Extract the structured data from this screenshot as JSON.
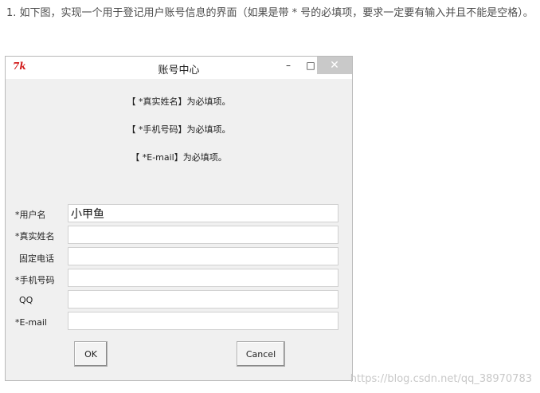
{
  "question": "1. 如下图，实现一个用于登记用户账号信息的界面（如果是带 * 号的必填项，要求一定要有输入并且不能是空格）。",
  "window": {
    "icon": "tk-feather-icon",
    "icon_text": "7k",
    "title": "账号中心",
    "minimize_glyph": "–",
    "maximize_glyph": "□",
    "close_glyph": "✕"
  },
  "notices": [
    "【 *真实姓名】为必填项。",
    "【 *手机号码】为必填项。",
    "【 *E-mail】为必填项。"
  ],
  "fields": [
    {
      "label": "*用户名",
      "value": "小甲鱼"
    },
    {
      "label": "*真实姓名",
      "value": ""
    },
    {
      "label": "固定电话",
      "value": ""
    },
    {
      "label": "*手机号码",
      "value": ""
    },
    {
      "label": "QQ",
      "value": ""
    },
    {
      "label": "*E-mail",
      "value": ""
    }
  ],
  "buttons": {
    "ok": "OK",
    "cancel": "Cancel"
  },
  "watermark": "https://blog.csdn.net/qq_38970783"
}
